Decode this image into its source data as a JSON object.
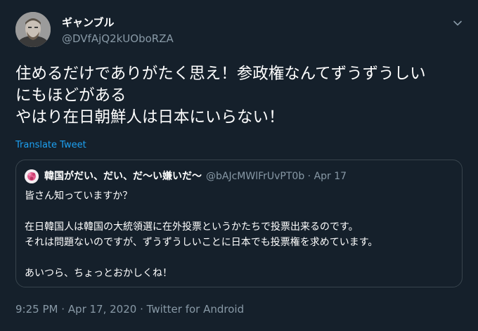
{
  "author": {
    "display_name": "ギャンブル",
    "handle": "@DVfAjQ2kUOboRZA"
  },
  "tweet": {
    "lines": [
      "住めるだけでありがたく思え！参政権なんてずうずうしい",
      "にもほどがある",
      "やはり在日朝鮮人は日本にいらない！"
    ],
    "translate_label": "Translate Tweet"
  },
  "quoted": {
    "display_name": "韓国がだい、だい、だ〜い嫌いだ〜",
    "handle": "@bAJcMWlFrUvPT0b",
    "separator": "·",
    "date": "Apr 17",
    "lines": [
      "皆さん知っていますか？",
      "",
      "在日韓国人は韓国の大統領選に在外投票というかたちで投票出来るのです。",
      "それは問題ないのですが、ずうずうしいことに日本でも投票権を求めています。",
      "",
      "あいつら、ちょっとおかしくね！"
    ]
  },
  "meta": {
    "time": "9:25 PM",
    "separator": "·",
    "date": "Apr 17, 2020",
    "source": "Twitter for Android"
  },
  "icons": {
    "caret": "chevron-down-icon",
    "avatar": "avatar",
    "quoted_avatar": "quoted-avatar"
  },
  "colors": {
    "background": "#15202b",
    "text": "#ffffff",
    "secondary": "#8899a6",
    "link": "#1da1f2",
    "border": "#38444d"
  }
}
